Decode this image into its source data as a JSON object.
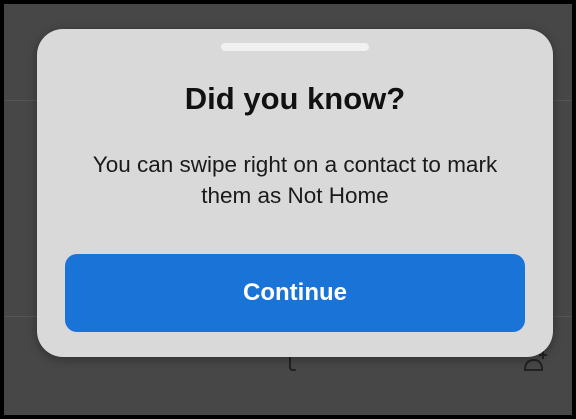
{
  "dialog": {
    "title": "Did you know?",
    "message": "You can swipe right on a contact to mark them as Not Home",
    "continue_label": "Continue"
  },
  "colors": {
    "accent": "#1a73d7",
    "sheet_background": "#d9d9d9",
    "screen_overlay": "#474747"
  },
  "icons": {
    "background_left": "pin-icon",
    "background_right": "add-contact-icon",
    "grabber": "sheet-grabber"
  }
}
